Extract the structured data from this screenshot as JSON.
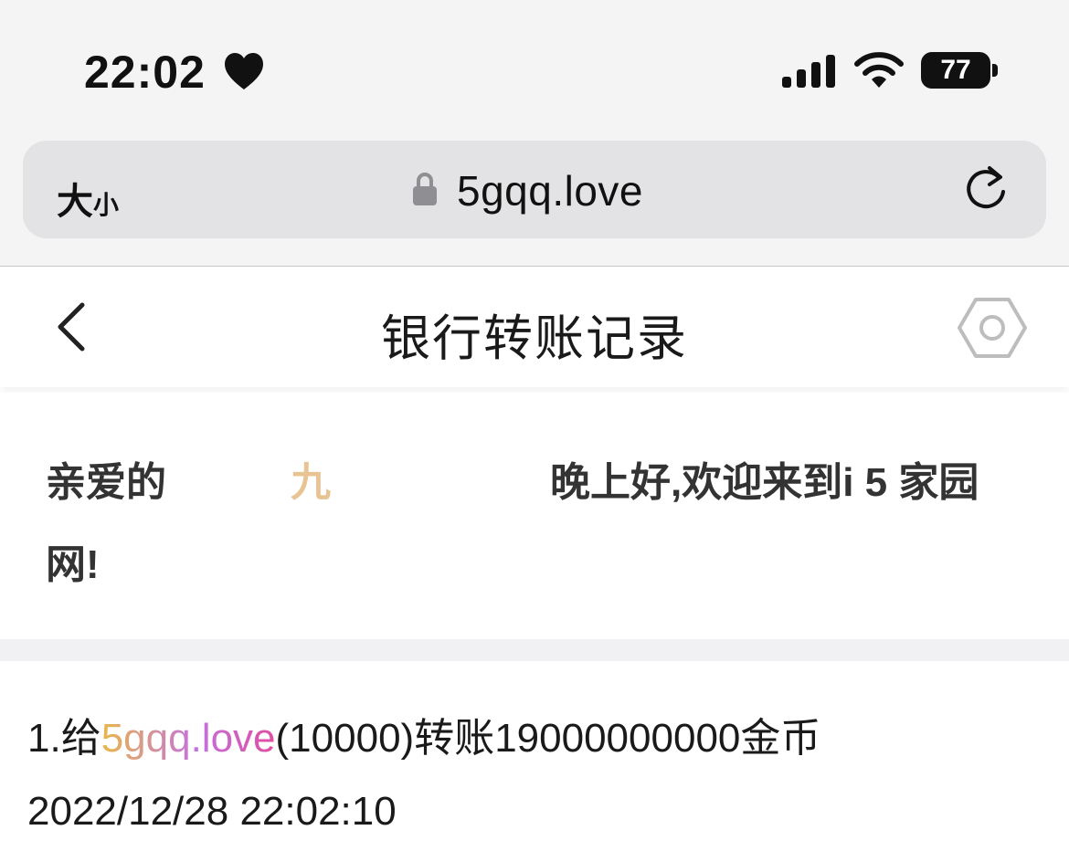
{
  "status_bar": {
    "time": "22:02",
    "battery": "77"
  },
  "browser": {
    "text_size_label_big": "大",
    "text_size_label_small": "小",
    "url": "5gqq.love"
  },
  "header": {
    "title": "银行转账记录"
  },
  "welcome": {
    "prefix": "亲爱的",
    "name": "九",
    "suffix": "晚上好,欢迎来到i 5 家园",
    "line2": "网!"
  },
  "records": [
    {
      "index": "1.",
      "text_before": "给",
      "recipient": "5gqq.love",
      "recipient_id": "(10000)",
      "text_after": "转账19000000000金币",
      "timestamp": "2022/12/28 22:02:10"
    }
  ],
  "colors": {
    "name_accent": "#e8c494",
    "link_gradient_start": "#e8b84a",
    "link_gradient_end": "#e04ea0",
    "separator": "#f1f1f4"
  },
  "icons": [
    "heart-icon",
    "signal-icon",
    "wifi-icon",
    "battery-icon",
    "lock-icon",
    "reload-icon",
    "back-icon",
    "settings-icon"
  ]
}
